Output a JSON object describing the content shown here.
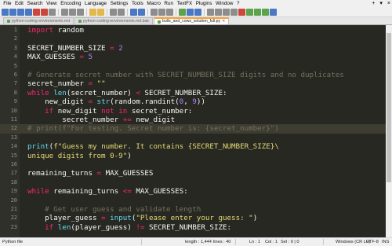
{
  "menu": {
    "items": [
      "File",
      "Edit",
      "Search",
      "View",
      "Encoding",
      "Language",
      "Settings",
      "Tools",
      "Macro",
      "Run",
      "TextFX",
      "Plugins",
      "Window",
      "?"
    ],
    "window_controls": [
      "+",
      "▾",
      "×"
    ]
  },
  "toolbar": {
    "icons": [
      "new-file-icon",
      "open-file-icon",
      "save-icon",
      "save-all-icon",
      "close-icon",
      "close-all-icon",
      "print-icon",
      "cut-icon",
      "copy-icon",
      "paste-icon",
      "undo-icon",
      "redo-icon",
      "find-icon",
      "replace-icon",
      "zoom-in-icon",
      "zoom-out-icon",
      "sync-v-icon",
      "sync-h-icon",
      "wrap-icon",
      "all-chars-icon",
      "indent-guide-icon",
      "lang-icon",
      "doc-map-icon",
      "function-list-icon",
      "folder-workspace-icon",
      "monitor-icon",
      "record-icon",
      "stop-icon",
      "play-icon",
      "play-multi-icon",
      "save-macro-icon"
    ]
  },
  "tabs": [
    {
      "label": "python-coding-environments.md",
      "active": false
    },
    {
      "label": "python-coding-environments.md.bak",
      "active": false
    },
    {
      "label": "bulls_and_cows_solution_full.py",
      "active": true
    }
  ],
  "editor": {
    "current_line": 12,
    "lines": [
      {
        "n": "1",
        "tokens": [
          [
            "kw",
            "import"
          ],
          [
            "pl",
            " random"
          ]
        ]
      },
      {
        "n": "2",
        "tokens": []
      },
      {
        "n": "3",
        "tokens": [
          [
            "pl",
            "SECRET_NUMBER_SIZE "
          ],
          [
            "kw",
            "="
          ],
          [
            "pl",
            " "
          ],
          [
            "num",
            "2"
          ]
        ]
      },
      {
        "n": "4",
        "tokens": [
          [
            "pl",
            "MAX_GUESSES "
          ],
          [
            "kw",
            "="
          ],
          [
            "pl",
            " "
          ],
          [
            "num",
            "5"
          ]
        ]
      },
      {
        "n": "5",
        "tokens": []
      },
      {
        "n": "6",
        "tokens": [
          [
            "com",
            "# Generate secret number with SECRET_NUMBER_SIZE digits and no duplicates"
          ]
        ]
      },
      {
        "n": "7",
        "tokens": [
          [
            "pl",
            "secret_number "
          ],
          [
            "kw",
            "="
          ],
          [
            "pl",
            " "
          ],
          [
            "str",
            "\"\""
          ]
        ]
      },
      {
        "n": "8",
        "tokens": [
          [
            "kw",
            "while"
          ],
          [
            "pl",
            " "
          ],
          [
            "fn",
            "len"
          ],
          [
            "pl",
            "(secret_number) "
          ],
          [
            "kw",
            "<"
          ],
          [
            "pl",
            " SECRET_NUMBER_SIZE:"
          ]
        ]
      },
      {
        "n": "9",
        "tokens": [
          [
            "pl",
            "    new_digit "
          ],
          [
            "kw",
            "="
          ],
          [
            "pl",
            " "
          ],
          [
            "fn",
            "str"
          ],
          [
            "pl",
            "(random.randint("
          ],
          [
            "num",
            "0"
          ],
          [
            "pl",
            ", "
          ],
          [
            "num",
            "9"
          ],
          [
            "pl",
            "))"
          ]
        ]
      },
      {
        "n": "10",
        "tokens": [
          [
            "pl",
            "    "
          ],
          [
            "kw",
            "if"
          ],
          [
            "pl",
            " new_digit "
          ],
          [
            "kw",
            "not in"
          ],
          [
            "pl",
            " secret_number:"
          ]
        ]
      },
      {
        "n": "11",
        "tokens": [
          [
            "pl",
            "        secret_number "
          ],
          [
            "kw",
            "+="
          ],
          [
            "pl",
            " new_digit"
          ]
        ]
      },
      {
        "n": "12",
        "tokens": [
          [
            "com",
            "# print(f\"For testing. Secret number is: {secret_number}\")"
          ]
        ]
      },
      {
        "n": "13",
        "tokens": []
      },
      {
        "n": "14",
        "tokens": [
          [
            "fn",
            "print"
          ],
          [
            "pl",
            "("
          ],
          [
            "str",
            "f\"Guess my number. It contains {SECRET_NUMBER_SIZE}\\"
          ]
        ]
      },
      {
        "n": "15",
        "tokens": [
          [
            "str",
            "unique digits from 0-9\""
          ],
          [
            "pl",
            ")"
          ]
        ]
      },
      {
        "n": "16",
        "tokens": []
      },
      {
        "n": "17",
        "tokens": [
          [
            "pl",
            "remaining_turns "
          ],
          [
            "kw",
            "="
          ],
          [
            "pl",
            " MAX_GUESSES"
          ]
        ]
      },
      {
        "n": "18",
        "tokens": []
      },
      {
        "n": "19",
        "tokens": [
          [
            "kw",
            "while"
          ],
          [
            "pl",
            " remaining_turns "
          ],
          [
            "kw",
            "<="
          ],
          [
            "pl",
            " MAX_GUESSES:"
          ]
        ]
      },
      {
        "n": "20",
        "tokens": []
      },
      {
        "n": "21",
        "tokens": [
          [
            "pl",
            "    "
          ],
          [
            "com",
            "# Get user guess and validate length"
          ]
        ]
      },
      {
        "n": "22",
        "tokens": [
          [
            "pl",
            "    player_guess "
          ],
          [
            "kw",
            "="
          ],
          [
            "pl",
            " "
          ],
          [
            "fn",
            "input"
          ],
          [
            "pl",
            "("
          ],
          [
            "str",
            "\"Please enter your guess: \""
          ],
          [
            "pl",
            ")"
          ]
        ]
      },
      {
        "n": "23",
        "tokens": [
          [
            "pl",
            "    "
          ],
          [
            "kw",
            "if"
          ],
          [
            "pl",
            " "
          ],
          [
            "fn",
            "len"
          ],
          [
            "pl",
            "(player_guess) "
          ],
          [
            "kw",
            "!="
          ],
          [
            "pl",
            " SECRET_NUMBER_SIZE:"
          ]
        ]
      }
    ]
  },
  "status": {
    "file_type": "Python file",
    "length": "length : 1,444",
    "lines": "lines : 40",
    "ln": "Ln : 1",
    "col": "Col : 1",
    "sel": "Sel : 0 | 0",
    "eol": "Windows (CR LF)",
    "encoding": "UTF-8",
    "mode": "INS"
  },
  "colors": {
    "background": "#272822",
    "keyword": "#f92672",
    "number": "#ae81ff",
    "string": "#e6db74",
    "comment": "#75715e",
    "builtin": "#66d9ef",
    "plain": "#f8f8f2"
  }
}
